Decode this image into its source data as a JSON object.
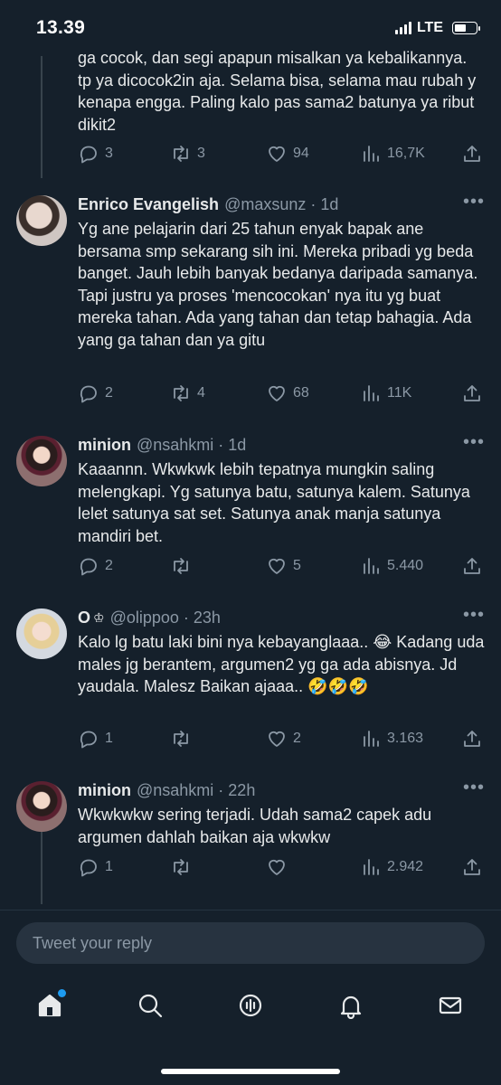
{
  "status_bar": {
    "time": "13.39",
    "network": "LTE"
  },
  "tweets": [
    {
      "text": "ga cocok, dan segi apapun misalkan ya kebalikannya. tp ya dicocok2in aja. Selama bisa, selama mau rubah y kenapa engga. Paling kalo pas sama2 batunya ya ribut dikit2",
      "replies": "3",
      "retweets": "3",
      "likes": "94",
      "views": "16,7K"
    },
    {
      "name": "Enrico Evangelish",
      "handle": "@maxsunz · 1d",
      "text": "Yg ane pelajarin dari 25 tahun enyak bapak ane bersama smp sekarang sih ini. Mereka pribadi yg beda banget. Jauh lebih banyak bedanya daripada samanya. Tapi justru ya proses 'mencocokan' nya itu yg buat mereka tahan. Ada yang tahan dan tetap bahagia. Ada yang ga tahan dan ya gitu",
      "replies": "2",
      "retweets": "4",
      "likes": "68",
      "views": "11K"
    },
    {
      "name": "minion",
      "handle": "@nsahkmi · 1d",
      "text": "Kaaannn. Wkwkwk lebih tepatnya mungkin saling melengkapi. Yg satunya batu, satunya kalem. Satunya lelet satunya sat set. Satunya anak manja satunya mandiri bet.",
      "replies": "2",
      "retweets": "",
      "likes": "5",
      "views": "5.440"
    },
    {
      "name": "O",
      "crown": "♔",
      "handle": "@olippoo · 23h",
      "text": "Kalo lg batu laki bini nya kebayanglaaa.. 😂 Kadang uda males jg berantem, argumen2 yg ga ada abisnya. Jd yaudala. Malesz Baikan ajaaa.. 🤣🤣🤣",
      "replies": "1",
      "retweets": "",
      "likes": "2",
      "views": "3.163"
    },
    {
      "name": "minion",
      "handle": "@nsahkmi · 22h",
      "text": "Wkwkwkw sering terjadi. Udah sama2 capek adu argumen dahlah baikan aja wkwkw",
      "replies": "1",
      "retweets": "",
      "likes": "",
      "views": "2.942"
    }
  ],
  "reply_box": {
    "placeholder": "Tweet your reply"
  },
  "nav": {
    "items": [
      "home-icon",
      "search-icon",
      "spaces-icon",
      "notifications-icon",
      "messages-icon"
    ]
  },
  "colors": {
    "background": "#15202b",
    "text": "#e7e9ea",
    "muted": "#8b98a5",
    "accent": "#1d9bf0"
  }
}
